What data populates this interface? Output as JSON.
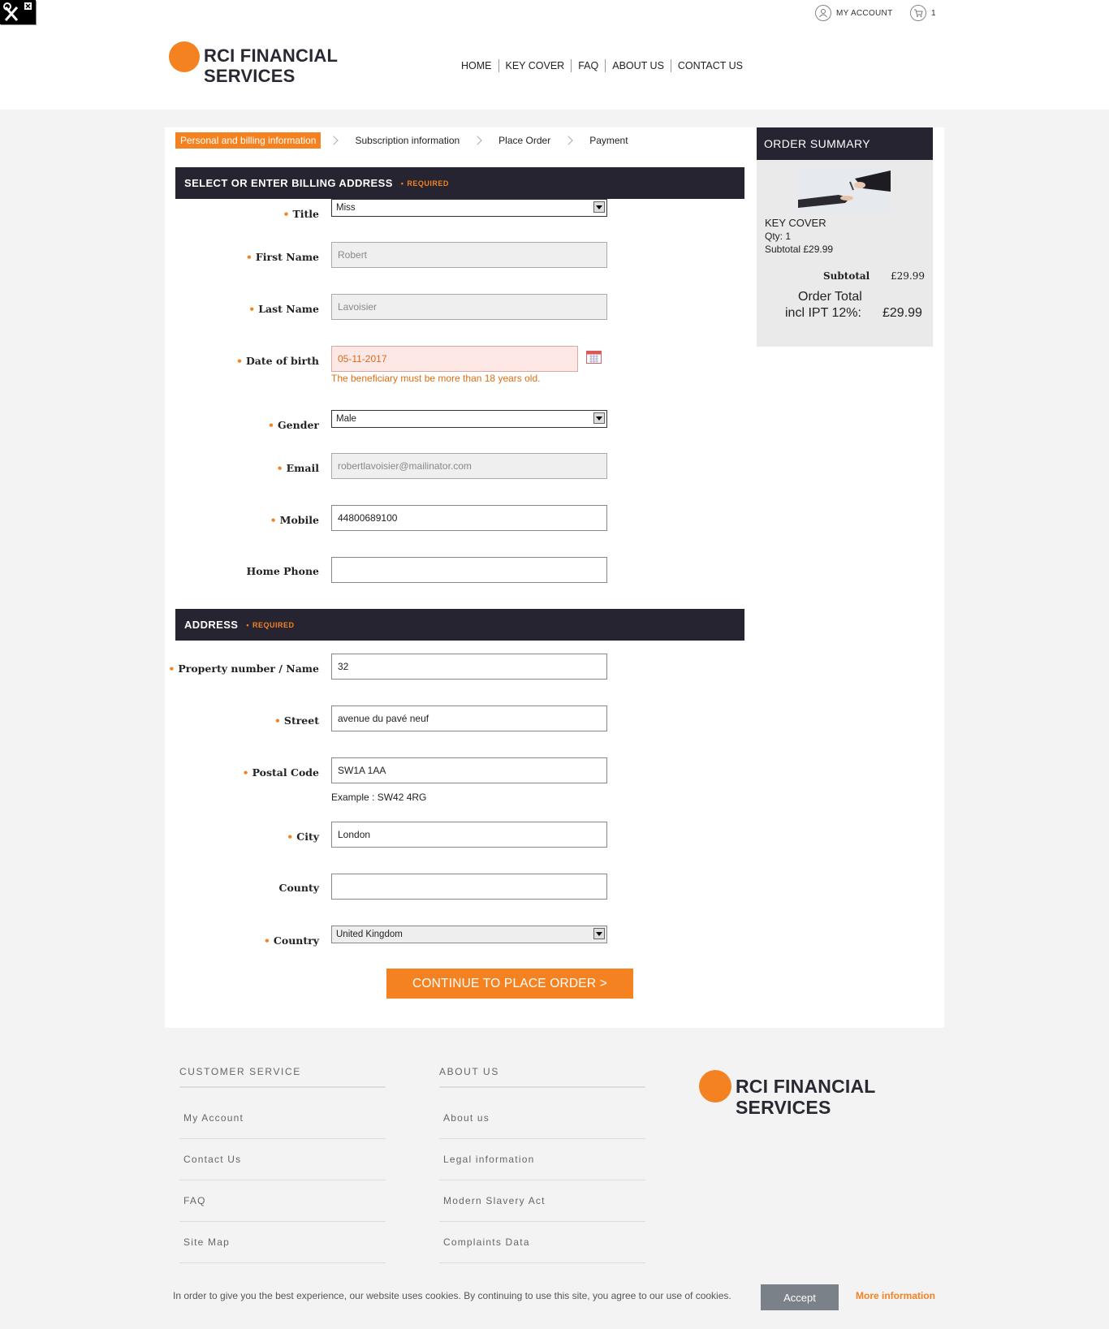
{
  "topbar": {
    "my_account": "MY ACCOUNT",
    "cart_count": "1"
  },
  "brand": {
    "line1": "RCI FINANCIAL",
    "line2": "SERVICES"
  },
  "nav": [
    "HOME",
    "KEY COVER",
    "FAQ",
    "ABOUT US",
    "CONTACT US"
  ],
  "steps": [
    "Personal and billing information",
    "Subscription information",
    "Place Order",
    "Payment"
  ],
  "billing": {
    "heading": "SELECT OR ENTER BILLING ADDRESS",
    "required": "REQUIRED",
    "title_label": "Title",
    "title_value": "Miss",
    "first_name_label": "First Name",
    "first_name_value": "Robert",
    "last_name_label": "Last Name",
    "last_name_value": "Lavoisier",
    "dob_label": "Date of birth",
    "dob_value": "05-11-2017",
    "dob_error": "The beneficiary must be more than 18 years old.",
    "gender_label": "Gender",
    "gender_value": "Male",
    "email_label": "Email",
    "email_value": "robertlavoisier@mailinator.com",
    "mobile_label": "Mobile",
    "mobile_value": "44800689100",
    "home_phone_label": "Home Phone",
    "home_phone_value": ""
  },
  "address": {
    "heading": "ADDRESS",
    "required": "REQUIRED",
    "property_label": "Property number / Name",
    "property_value": "32",
    "street_label": "Street",
    "street_value": "avenue du pavé neuf",
    "postal_label": "Postal Code",
    "postal_value": "SW1A 1AA",
    "postal_example": "Example : SW42 4RG",
    "city_label": "City",
    "city_value": "London",
    "county_label": "County",
    "county_value": "",
    "country_label": "Country",
    "country_value": "United Kingdom"
  },
  "continue_button": "CONTINUE TO PLACE ORDER >",
  "summary": {
    "heading": "ORDER SUMMARY",
    "product": "KEY COVER",
    "qty": "Qty: 1",
    "line_subtotal": "Subtotal £29.99",
    "subtotal_label": "Subtotal",
    "subtotal_value": "£29.99",
    "total_label_1": "Order Total",
    "total_label_2": "incl IPT 12%:",
    "total_value": "£29.99"
  },
  "footer": {
    "customer_service": {
      "heading": "CUSTOMER SERVICE",
      "links": [
        "My Account",
        "Contact Us",
        "FAQ",
        "Site Map"
      ]
    },
    "about": {
      "heading": "ABOUT US",
      "links": [
        "About us",
        "Legal information",
        "Modern Slavery Act",
        "Complaints Data"
      ]
    }
  },
  "cookie": {
    "text": "In order to give you the best experience, our website uses cookies. By continuing to use this site, you agree to our use of cookies.",
    "accept": "Accept",
    "more": "More information"
  },
  "colors": {
    "accent": "#f58220",
    "dark": "#262431"
  }
}
